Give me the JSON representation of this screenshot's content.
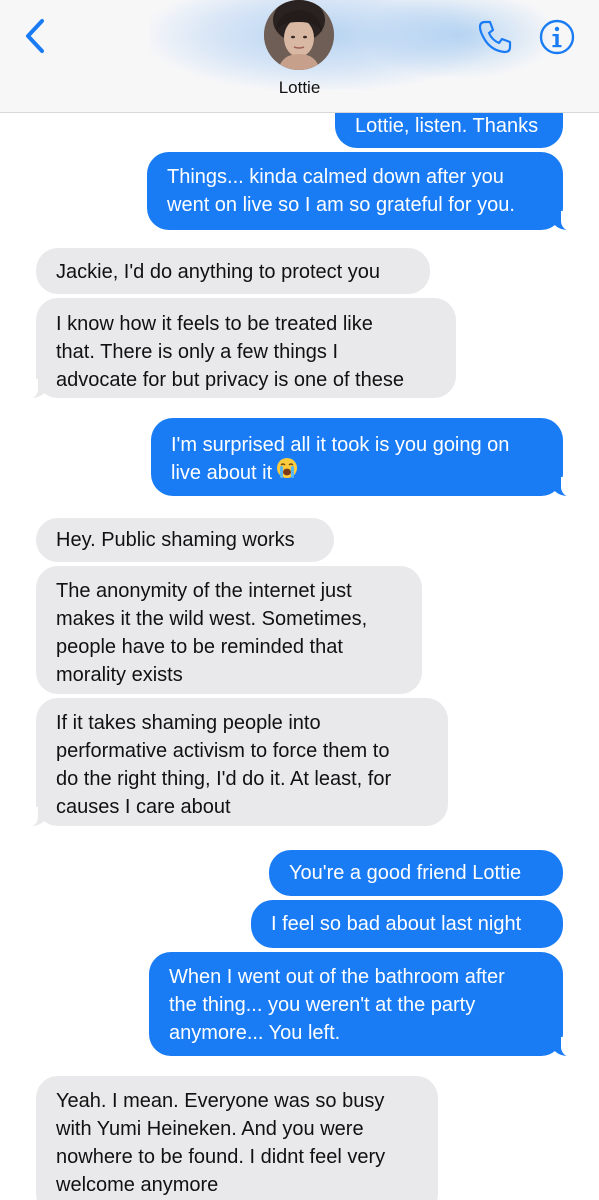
{
  "header": {
    "contact_name": "Lottie",
    "back_icon": "chevron-left-icon",
    "phone_icon": "phone-icon",
    "info_icon": "info-icon"
  },
  "colors": {
    "sent_bubble": "#1a7cf5",
    "received_bubble": "#e9e9eb",
    "accent": "#1a7cf5"
  },
  "messages": [
    {
      "side": "sent",
      "lines": [
        "Lottie, listen. Thanks"
      ]
    },
    {
      "side": "sent",
      "lines": [
        "Things... kinda calmed down after you",
        "went on live so I am so grateful for you."
      ]
    },
    {
      "side": "received",
      "lines": [
        "Jackie, I'd do anything to protect you"
      ]
    },
    {
      "side": "received",
      "lines": [
        "I know how it feels to be treated like",
        "that. There is only a few things I",
        "advocate for but privacy is one of these"
      ]
    },
    {
      "side": "sent",
      "lines": [
        "I'm surprised all it took is you going on",
        "live about it"
      ],
      "emoji": "loudly-crying-face-icon"
    },
    {
      "side": "received",
      "lines": [
        "Hey. Public shaming works"
      ]
    },
    {
      "side": "received",
      "lines": [
        "The anonymity of the internet just",
        "makes it the wild west. Sometimes,",
        "people have to be reminded that",
        "morality exists"
      ]
    },
    {
      "side": "received",
      "lines": [
        "If it takes shaming people into",
        "performative activism to force them to",
        "do the right thing, I'd do it. At least, for",
        "causes I care about"
      ]
    },
    {
      "side": "sent",
      "lines": [
        "You're a good friend Lottie"
      ]
    },
    {
      "side": "sent",
      "lines": [
        "I feel so bad about last night"
      ]
    },
    {
      "side": "sent",
      "lines": [
        "When I went out of the bathroom after",
        "the thing... you weren't at the party",
        "anymore... You left."
      ]
    },
    {
      "side": "received",
      "lines": [
        "Yeah. I mean. Everyone was so busy",
        "with Yumi Heineken. And you were",
        "nowhere to be found. I didnt feel very",
        "welcome anymore"
      ]
    }
  ]
}
